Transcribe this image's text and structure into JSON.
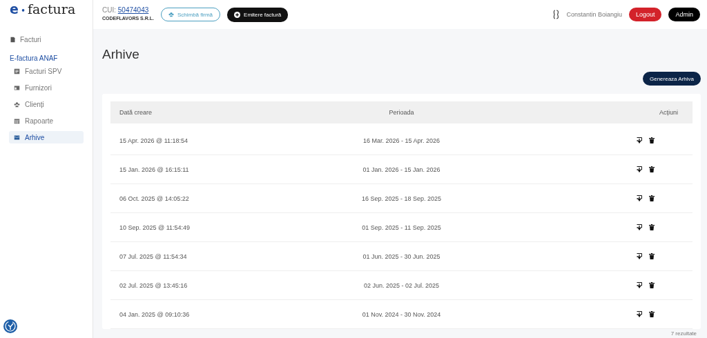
{
  "logo": {
    "main": "e",
    "dot": "•",
    "rest": "factura"
  },
  "company": {
    "cui_label": "CUI:",
    "cui": "50474043",
    "name": "CODEFLAVORS S.R.L."
  },
  "header_buttons": {
    "switch": "Schimbă firmă",
    "issue": "Emitere factură"
  },
  "user": {
    "name": "Constantin Boiangiu",
    "logout": "Logout",
    "admin": "Admin"
  },
  "sidebar": {
    "top": {
      "label": "Facturi"
    },
    "section": "E-factura ANAF",
    "items": [
      {
        "label": "Facturi SPV",
        "selected": false
      },
      {
        "label": "Furnizori",
        "selected": false
      },
      {
        "label": "Clienți",
        "selected": false
      },
      {
        "label": "Rapoarte",
        "selected": false
      },
      {
        "label": "Arhive",
        "selected": true
      }
    ]
  },
  "page": {
    "title": "Arhive",
    "generate_button": "Genereaza Arhiva"
  },
  "table": {
    "columns": [
      "Dată creare",
      "Perioada",
      "Acțiuni"
    ],
    "rows": [
      {
        "created": "15 Apr. 2026 @ 11:18:54",
        "period": "16 Mar. 2026 - 15 Apr. 2026"
      },
      {
        "created": "15 Jan. 2026 @ 16:15:11",
        "period": "01 Jan. 2026 - 15 Jan. 2026"
      },
      {
        "created": "06 Oct. 2025 @ 14:05:22",
        "period": "16 Sep. 2025 - 18 Sep. 2025"
      },
      {
        "created": "10 Sep. 2025 @ 11:54:49",
        "period": "01 Sep. 2025 - 11 Sep. 2025"
      },
      {
        "created": "07 Jul. 2025 @ 11:54:34",
        "period": "01 Jun. 2025 - 30 Jun. 2025"
      },
      {
        "created": "02 Jul. 2025 @ 13:45:16",
        "period": "02 Jun. 2025 - 02 Jul. 2025"
      },
      {
        "created": "04 Jan. 2025 @ 09:10:36",
        "period": "01 Nov. 2024 - 30 Nov. 2024"
      }
    ],
    "results": "7 rezultate"
  }
}
